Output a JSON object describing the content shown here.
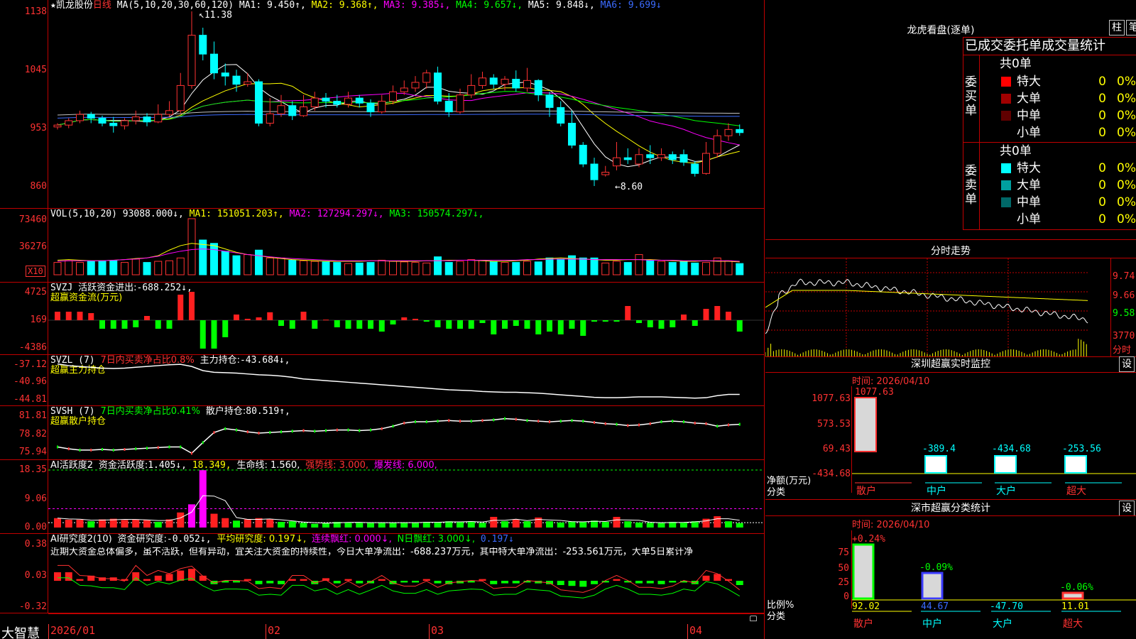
{
  "main": {
    "star": "★",
    "stock_name": "凯龙股份",
    "period": "日线",
    "ma_label": "MA(5,10,20,30,60,120)",
    "ma1": "MA1: 9.450↑,",
    "ma2": "MA2: 9.368↑,",
    "ma3": "MA3: 9.385↓,",
    "ma4": "MA4: 9.657↓,",
    "ma5": "MA5: 9.848↓,",
    "ma6": "MA6: 9.699↓",
    "yticks": [
      "1138",
      "1045",
      "953",
      "860"
    ],
    "high_label": "11.38",
    "low_label": "8.60",
    "candles": [
      [
        9.54,
        9.57,
        9.6,
        9.5
      ],
      [
        9.57,
        9.64,
        9.68,
        9.52
      ],
      [
        9.64,
        9.74,
        9.8,
        9.6
      ],
      [
        9.74,
        9.68,
        9.78,
        9.6
      ],
      [
        9.68,
        9.6,
        9.72,
        9.55
      ],
      [
        9.6,
        9.56,
        9.7,
        9.45
      ],
      [
        9.56,
        9.64,
        9.68,
        9.5
      ],
      [
        9.64,
        9.7,
        9.8,
        9.58
      ],
      [
        9.7,
        9.62,
        9.76,
        9.55
      ],
      [
        9.62,
        9.74,
        9.9,
        9.6
      ],
      [
        9.74,
        9.8,
        9.95,
        9.7
      ],
      [
        9.8,
        10.2,
        10.4,
        9.76
      ],
      [
        10.2,
        11.0,
        11.38,
        10.15
      ],
      [
        11.0,
        10.7,
        11.12,
        10.6
      ],
      [
        10.7,
        10.4,
        10.9,
        10.3
      ],
      [
        10.4,
        10.35,
        10.55,
        10.2
      ],
      [
        10.35,
        10.22,
        10.45,
        10.1
      ],
      [
        10.22,
        10.26,
        10.4,
        10.18
      ],
      [
        10.26,
        9.6,
        10.3,
        9.55
      ],
      [
        9.6,
        9.75,
        10.0,
        9.55
      ],
      [
        9.75,
        9.88,
        10.05,
        9.7
      ],
      [
        9.88,
        9.72,
        9.95,
        9.65
      ],
      [
        9.72,
        9.86,
        10.05,
        9.7
      ],
      [
        9.86,
        10.0,
        10.1,
        9.8
      ],
      [
        10.0,
        9.95,
        10.08,
        9.85
      ],
      [
        9.95,
        9.9,
        10.05,
        9.85
      ],
      [
        9.9,
        10.0,
        10.1,
        9.85
      ],
      [
        10.0,
        9.92,
        10.05,
        9.85
      ],
      [
        9.92,
        9.78,
        9.98,
        9.7
      ],
      [
        9.78,
        9.95,
        10.05,
        9.75
      ],
      [
        9.95,
        10.1,
        10.2,
        9.9
      ],
      [
        10.1,
        10.16,
        10.28,
        10.05
      ],
      [
        10.16,
        10.25,
        10.35,
        10.1
      ],
      [
        10.25,
        10.4,
        10.45,
        10.15
      ],
      [
        10.4,
        9.95,
        10.5,
        9.9
      ],
      [
        9.95,
        9.78,
        10.08,
        9.7
      ],
      [
        9.78,
        10.05,
        10.15,
        9.75
      ],
      [
        10.05,
        10.2,
        10.38,
        10.0
      ],
      [
        10.2,
        10.32,
        10.42,
        10.15
      ],
      [
        10.32,
        10.22,
        10.38,
        10.15
      ],
      [
        10.22,
        10.3,
        10.35,
        10.12
      ],
      [
        10.3,
        10.16,
        10.44,
        10.1
      ],
      [
        10.16,
        10.28,
        10.48,
        10.1
      ],
      [
        10.28,
        10.05,
        10.3,
        9.95
      ],
      [
        10.05,
        9.85,
        10.1,
        9.7
      ],
      [
        9.85,
        9.6,
        9.95,
        9.55
      ],
      [
        9.6,
        9.25,
        9.8,
        9.2
      ],
      [
        9.25,
        8.95,
        9.3,
        8.9
      ],
      [
        8.95,
        8.7,
        9.05,
        8.6
      ],
      [
        8.78,
        8.82,
        8.92,
        8.75
      ],
      [
        8.92,
        9.05,
        9.3,
        8.85
      ],
      [
        9.05,
        9.02,
        9.2,
        8.95
      ],
      [
        8.95,
        9.1,
        9.2,
        8.9
      ],
      [
        9.1,
        9.05,
        9.25,
        8.95
      ],
      [
        9.05,
        9.1,
        9.2,
        9.0
      ],
      [
        9.1,
        9.02,
        9.15,
        8.95
      ],
      [
        9.1,
        8.98,
        9.18,
        8.92
      ],
      [
        8.95,
        8.8,
        9.0,
        8.75
      ],
      [
        8.8,
        9.12,
        9.3,
        8.78
      ],
      [
        9.12,
        9.4,
        9.5,
        9.05
      ],
      [
        9.4,
        9.5,
        9.6,
        9.32
      ],
      [
        9.5,
        9.45,
        9.58,
        9.4
      ]
    ]
  },
  "vol": {
    "label": "VOL(5,10,20)",
    "value": "93088.000↓,",
    "ma1": "MA1: 151051.203↑,",
    "ma2": "MA2: 127294.297↓,",
    "ma3": "MA3: 150574.297↓,",
    "yticks": [
      "73460",
      "36276"
    ],
    "unit": "X10",
    "bars": [
      0.22,
      0.25,
      0.22,
      0.24,
      0.25,
      0.25,
      0.22,
      0.28,
      0.22,
      0.24,
      0.25,
      0.3,
      1.0,
      0.62,
      0.56,
      0.42,
      0.34,
      0.36,
      0.44,
      0.3,
      0.3,
      0.26,
      0.25,
      0.24,
      0.23,
      0.22,
      0.2,
      0.21,
      0.22,
      0.26,
      0.24,
      0.23,
      0.22,
      0.21,
      0.32,
      0.22,
      0.24,
      0.27,
      0.26,
      0.24,
      0.22,
      0.22,
      0.24,
      0.23,
      0.3,
      0.28,
      0.34,
      0.3,
      0.3,
      0.21,
      0.24,
      0.22,
      0.36,
      0.26,
      0.24,
      0.22,
      0.24,
      0.21,
      0.22,
      0.3,
      0.25,
      0.2
    ],
    "ma_series": [
      [
        0.26,
        0.27,
        0.26,
        0.25,
        0.25,
        0.26,
        0.27,
        0.29,
        0.3,
        0.34,
        0.44,
        0.52,
        0.56,
        0.54,
        0.52,
        0.46,
        0.4,
        0.36,
        0.34,
        0.31,
        0.29,
        0.27,
        0.26,
        0.25,
        0.24,
        0.24,
        0.24,
        0.24,
        0.25,
        0.25,
        0.24,
        0.24,
        0.24,
        0.25,
        0.25,
        0.26,
        0.26,
        0.26,
        0.25,
        0.24,
        0.24,
        0.25,
        0.26,
        0.28,
        0.29,
        0.3,
        0.29,
        0.28,
        0.27,
        0.26,
        0.26,
        0.27,
        0.27,
        0.27,
        0.26,
        0.25,
        0.24,
        0.24,
        0.25,
        0.24,
        0.24,
        0.23
      ],
      [
        0.24,
        0.25,
        0.25,
        0.25,
        0.25,
        0.26,
        0.27,
        0.28,
        0.3,
        0.33,
        0.38,
        0.42,
        0.45,
        0.46,
        0.45,
        0.42,
        0.39,
        0.36,
        0.34,
        0.32,
        0.3,
        0.29,
        0.28,
        0.27,
        0.26,
        0.25,
        0.25,
        0.25,
        0.25,
        0.25,
        0.25,
        0.25,
        0.25,
        0.25,
        0.25,
        0.25,
        0.26,
        0.26,
        0.26,
        0.26,
        0.26,
        0.26,
        0.27,
        0.27,
        0.28,
        0.28,
        0.28,
        0.28,
        0.27,
        0.27,
        0.27,
        0.27,
        0.27,
        0.26,
        0.26,
        0.26,
        0.25,
        0.25,
        0.25,
        0.25,
        0.25,
        0.24
      ]
    ],
    "ma_colors": [
      "#ffff00",
      "#ff00ff"
    ]
  },
  "svzj": {
    "label": "SVZJ",
    "title": "活跃资金进出:",
    "value": "-688.252↓,",
    "sub": "超赢资金流(万元)",
    "yticks": [
      "4725",
      "169",
      "-4386"
    ],
    "bars": [
      0.3,
      0.3,
      0.3,
      0.25,
      -0.3,
      -0.3,
      -0.3,
      -0.25,
      0.15,
      -0.3,
      -0.3,
      0.9,
      1.0,
      -1.0,
      -1.0,
      -0.6,
      0.2,
      0.05,
      0.1,
      0.28,
      -0.2,
      -0.3,
      0.3,
      -0.3,
      0.02,
      -0.25,
      -0.3,
      -0.3,
      -0.3,
      -0.4,
      -0.15,
      0.1,
      0.05,
      -0.05,
      -0.25,
      -0.3,
      -0.3,
      -0.3,
      -0.1,
      -0.5,
      -0.3,
      -0.2,
      -0.3,
      -0.5,
      -0.4,
      -0.5,
      -0.3,
      -0.55,
      -0.05,
      -0.05,
      -0.05,
      0.5,
      -0.1,
      -0.25,
      -0.3,
      -0.25,
      0.2,
      -0.2,
      0.4,
      0.5,
      0.3,
      -0.4
    ]
  },
  "svzl": {
    "label": "SVZL (7)",
    "title": "7日内买卖净占比0.8%",
    "sub_title": "主力持仓:",
    "value": "-43.684↓,",
    "sub": "超赢主力持仓",
    "yticks": [
      "-37.12",
      "-40.96",
      "-44.81"
    ],
    "line": [
      -36.4,
      -36.8,
      -37.0,
      -37.2,
      -37.4,
      -37.5,
      -37.4,
      -37.2,
      -37.0,
      -36.8,
      -36.6,
      -36.5,
      -37.0,
      -38.0,
      -38.4,
      -38.5,
      -38.6,
      -38.8,
      -39.0,
      -39.1,
      -39.3,
      -39.6,
      -40.0,
      -40.2,
      -40.4,
      -40.6,
      -40.8,
      -41.0,
      -41.2,
      -41.4,
      -41.6,
      -41.8,
      -42.0,
      -42.2,
      -42.4,
      -42.6,
      -42.7,
      -42.8,
      -43.0,
      -43.1,
      -43.2,
      -43.2,
      -43.3,
      -43.4,
      -43.6,
      -43.8,
      -44.0,
      -44.2,
      -44.4,
      -44.5,
      -44.5,
      -44.4,
      -44.3,
      -44.3,
      -44.3,
      -44.4,
      -44.5,
      -44.6,
      -44.5,
      -44.0,
      -43.7,
      -43.7
    ]
  },
  "svsh": {
    "label": "SVSH (7)",
    "title": "7日内买卖净占比0.41%",
    "sub_title": "散户持仓:",
    "value": "80.519↑,",
    "sub": "超赢散户持仓",
    "yticks": [
      "81.81",
      "78.82",
      "75.94"
    ],
    "line": [
      76.9,
      76.6,
      76.4,
      76.4,
      76.5,
      76.4,
      76.5,
      76.6,
      76.7,
      76.8,
      76.9,
      76.9,
      75.9,
      77.6,
      79.2,
      79.8,
      79.6,
      79.3,
      79.1,
      79.2,
      79.3,
      79.4,
      79.5,
      79.4,
      79.5,
      79.6,
      79.6,
      79.5,
      79.6,
      79.8,
      80.2,
      80.7,
      80.9,
      80.9,
      81.0,
      81.1,
      81.0,
      81.0,
      81.1,
      81.2,
      81.4,
      81.3,
      81.1,
      81.0,
      80.9,
      81.0,
      81.1,
      81.0,
      80.8,
      80.6,
      80.5,
      80.3,
      80.4,
      80.6,
      80.9,
      81.0,
      80.9,
      80.7,
      80.6,
      80.2,
      80.4,
      80.5
    ],
    "marks": [
      0,
      1,
      0,
      1,
      0,
      0,
      1,
      0,
      0,
      1,
      0,
      0,
      1,
      0,
      1,
      0,
      0,
      1,
      1,
      0,
      0,
      0,
      1,
      0,
      0,
      1,
      0,
      0,
      0,
      1,
      0,
      1,
      0,
      0,
      0,
      1,
      1,
      0,
      1,
      0,
      0,
      1,
      0,
      1,
      1,
      0,
      0,
      0,
      1,
      1,
      0,
      1,
      1,
      1,
      0,
      0,
      0,
      1,
      1,
      0,
      1,
      0
    ]
  },
  "ai1": {
    "label": "AI活跃度2",
    "title": "资金活跃度:",
    "value": "1.405↓,",
    "v2": "18.349,",
    "life": "生命线: 1.560,",
    "strong": "强势线: 3.000,",
    "burst": "爆发线: 6.000,",
    "yticks": [
      "18.35",
      "9.06",
      "0.00"
    ],
    "bars": [
      3.0,
      2.5,
      2.5,
      2.0,
      2.6,
      2.8,
      2.4,
      2.5,
      2.4,
      1.8,
      2.6,
      4.8,
      7.4,
      18.3,
      4.4,
      3.0,
      2.2,
      2.6,
      3.0,
      2.6,
      1.8,
      2.0,
      1.5,
      1.2,
      1.5,
      1.8,
      1.6,
      1.6,
      1.5,
      1.6,
      1.5,
      1.6,
      1.6,
      1.8,
      1.6,
      2.0,
      1.8,
      2.0,
      1.5,
      3.4,
      2.0,
      2.6,
      2.0,
      3.2,
      2.0,
      1.6,
      2.0,
      1.8,
      2.2,
      1.8,
      3.4,
      2.0,
      1.6,
      1.5,
      1.5,
      1.8,
      1.6,
      2.0,
      2.8,
      3.6,
      2.0,
      1.4
    ]
  },
  "ai2": {
    "label": "AI研究度2(10)",
    "title": "资金研究度:",
    "value": "-0.052↓,",
    "avg": "平均研究度: 0.197↓,",
    "lian": "连续飘红: 0.000↓,",
    "nday": "N日飘红: 3.000↓,",
    "last": "0.197↓",
    "text": "近期大资金总体偏多，虽不活跃，但有异动，宜关注大资金的持续性，今日大单净流出：-688.237万元，其中特大单净流出：-253.561万元，大单5日累计净",
    "yticks": [
      "0.38",
      "0.03",
      "-0.32"
    ],
    "bars": [
      0.1,
      0.1,
      0.02,
      0.06,
      0.04,
      0.04,
      0.02,
      0.1,
      0.02,
      0.06,
      0.08,
      0.12,
      0.14,
      0.06,
      -0.04,
      -0.02,
      -0.02,
      0.02,
      -0.04,
      -0.03,
      -0.04,
      0.02,
      0.02,
      -0.04,
      0.03,
      -0.03,
      0.02,
      -0.03,
      -0.03,
      0.02,
      -0.04,
      -0.02,
      -0.02,
      0.02,
      -0.03,
      -0.04,
      -0.03,
      -0.02,
      0.02,
      -0.04,
      -0.03,
      -0.03,
      -0.02,
      -0.03,
      -0.04,
      -0.05,
      -0.06,
      -0.07,
      -0.04,
      -0.02,
      0.02,
      -0.02,
      -0.03,
      -0.03,
      -0.04,
      -0.02,
      -0.02,
      -0.04,
      0.06,
      0.08,
      0.02,
      -0.05
    ]
  },
  "xaxis": {
    "label_left": "大智慧",
    "labels": [
      [
        "2026/01",
        0
      ],
      [
        "02",
        18
      ],
      [
        "03",
        33
      ],
      [
        "04",
        56
      ]
    ]
  },
  "longhu": {
    "title": "龙虎看盘(逐单)",
    "btn_zhu": "柱",
    "btn_bi": "笔",
    "header": "已成交委托单成交量统计",
    "buy_label": "委买单",
    "sell_label": "委卖单",
    "buy_total": "共0单",
    "sell_total": "共0单",
    "buy_rows": [
      {
        "name": "特大",
        "color": "#ff0000",
        "count": "0",
        "pct": "0%"
      },
      {
        "name": "大单",
        "color": "#a00000",
        "count": "0",
        "pct": "0%"
      },
      {
        "name": "中单",
        "color": "#600000",
        "count": "0",
        "pct": "0%"
      },
      {
        "name": "小单",
        "color": "#000000",
        "count": "0",
        "pct": "0%"
      }
    ],
    "sell_rows": [
      {
        "name": "特大",
        "color": "#00ffff",
        "count": "0",
        "pct": "0%"
      },
      {
        "name": "大单",
        "color": "#00a0a0",
        "count": "0",
        "pct": "0%"
      },
      {
        "name": "中单",
        "color": "#006868",
        "count": "0",
        "pct": "0%"
      },
      {
        "name": "小单",
        "color": "#000000",
        "count": "0",
        "pct": "0%"
      }
    ]
  },
  "fenshi": {
    "title": "分时走势",
    "yticks": [
      "9.74",
      "9.66",
      "9.58"
    ],
    "vol_tick": "3770",
    "vol_unit": "分时"
  },
  "monitor": {
    "title": "深圳超赢实时监控",
    "btn": "设",
    "time": "时间: 2026/04/10",
    "yticks": [
      "1077.63",
      "573.53",
      "69.43",
      "-434.68"
    ],
    "y_label": "净额(万元)",
    "cat_label": "分类",
    "categories": [
      "散户",
      "中户",
      "大户",
      "超大"
    ],
    "values": [
      "1077.63",
      "-389.4",
      "-434.68",
      "-253.56"
    ]
  },
  "classify": {
    "title": "深市超赢分类统计",
    "btn": "设",
    "time": "时间: 2026/04/10",
    "yticks": [
      "75",
      "50",
      "25",
      "0"
    ],
    "y_label": "比例%",
    "cat_label": "分类",
    "categories": [
      "散户",
      "中户",
      "大户",
      "超大"
    ],
    "top_labels": [
      "+0.24%",
      "-0.09%",
      "",
      "-0.06%"
    ],
    "values": [
      "92.02",
      "44.67",
      "-47.70",
      "11.01"
    ]
  }
}
